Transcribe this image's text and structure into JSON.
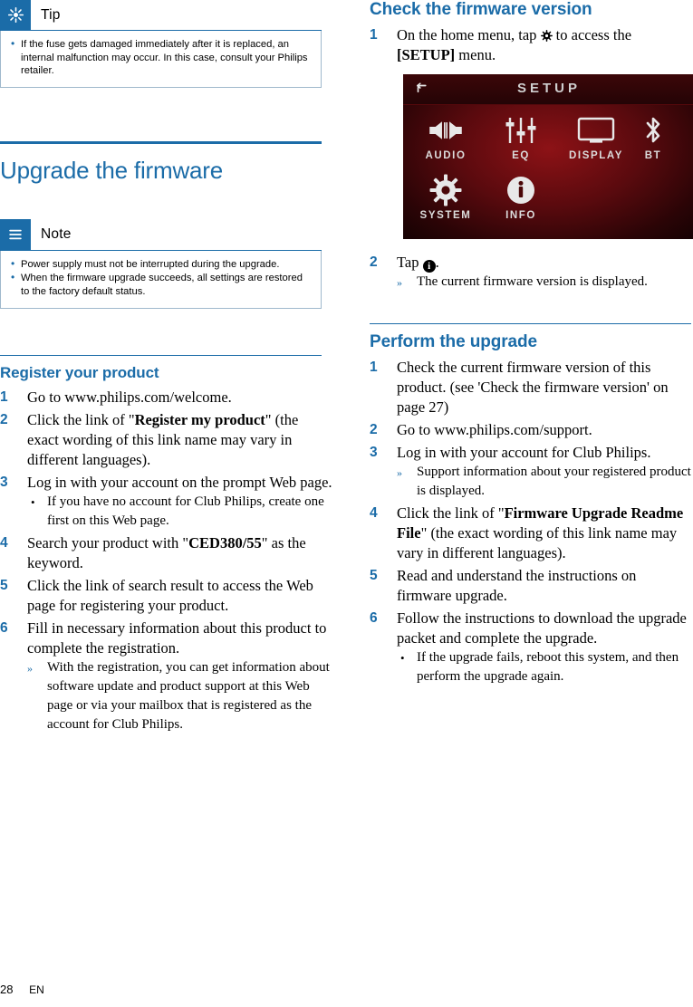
{
  "left": {
    "tip": {
      "icon": "tip-icon",
      "title": "Tip",
      "items": [
        "If the fuse gets damaged immediately after it is replaced, an internal malfunction may occur. In this case, consult your Philips retailer."
      ]
    },
    "chapter_title": "Upgrade the firmware",
    "note": {
      "icon": "note-icon",
      "title": "Note",
      "items": [
        "Power supply must not be interrupted during the upgrade.",
        "When the firmware upgrade succeeds, all settings are restored to the factory default status."
      ]
    },
    "section_title": "Register your product",
    "steps": [
      {
        "num": "1",
        "text": "Go to www.philips.com/welcome."
      },
      {
        "num": "2",
        "html": "Click the link of \"<b>Register my product</b>\" (the exact wording of this link name may vary in different languages)."
      },
      {
        "num": "3",
        "text": "Log in with your account on the prompt Web page.",
        "subs": [
          {
            "type": "bullet",
            "text": "If you have no account for Club Philips, create one first on this Web page."
          }
        ]
      },
      {
        "num": "4",
        "html": "Search your product with \"<b>CED380/55</b>\" as the keyword."
      },
      {
        "num": "5",
        "text": "Click the link of search result to access the Web page for registering your product."
      },
      {
        "num": "6",
        "text": "Fill in necessary information about this product to complete the registration.",
        "subs": [
          {
            "type": "arrow",
            "text": "With the registration, you can get information about software update and product support at this Web page or via your mailbox that is registered as the account for Club Philips."
          }
        ]
      }
    ]
  },
  "right": {
    "section_title_1": "Check the firmware version",
    "steps_1": [
      {
        "num": "1",
        "html": "On the home menu, tap <span class=\"gear\"></span> to access the <b>[SETUP]</b> menu."
      }
    ],
    "device": {
      "back_icon": "back-arrow-icon",
      "title": "SETUP",
      "items": [
        {
          "icon": "speaker-icon",
          "label": "AUDIO"
        },
        {
          "icon": "equalizer-icon",
          "label": "EQ"
        },
        {
          "icon": "display-icon",
          "label": "DISPLAY"
        },
        {
          "icon": "bluetooth-icon",
          "label": "BT"
        },
        {
          "icon": "gear-icon",
          "label": "SYSTEM"
        },
        {
          "icon": "info-icon",
          "label": "INFO"
        }
      ]
    },
    "steps_2": [
      {
        "num": "2",
        "html": "Tap <span class=\"info\">i</span>.",
        "subs": [
          {
            "type": "arrow",
            "text": "The current firmware version is displayed."
          }
        ]
      }
    ],
    "section_title_2": "Perform the upgrade",
    "steps_3": [
      {
        "num": "1",
        "text": "Check the current firmware version of this product. (see 'Check the firmware version' on page 27)"
      },
      {
        "num": "2",
        "text": "Go to www.philips.com/support."
      },
      {
        "num": "3",
        "text": "Log in with your account for Club Philips.",
        "subs": [
          {
            "type": "arrow",
            "text": "Support information about your registered product is displayed."
          }
        ]
      },
      {
        "num": "4",
        "html": "Click the link of \"<b>Firmware Upgrade Readme File</b>\" (the exact wording of this link name may vary in different languages)."
      },
      {
        "num": "5",
        "text": "Read and understand the instructions on firmware upgrade."
      },
      {
        "num": "6",
        "text": "Follow the instructions to download the upgrade packet and complete the upgrade.",
        "subs": [
          {
            "type": "bullet",
            "text": "If the upgrade fails, reboot this system, and then perform the upgrade again."
          }
        ]
      }
    ]
  },
  "footer": {
    "page_number": "28",
    "language": "EN"
  },
  "colors": {
    "accent": "#1b6ca8",
    "callout_border": "#9fb8cc",
    "device_bg": "#5a0a0e"
  }
}
